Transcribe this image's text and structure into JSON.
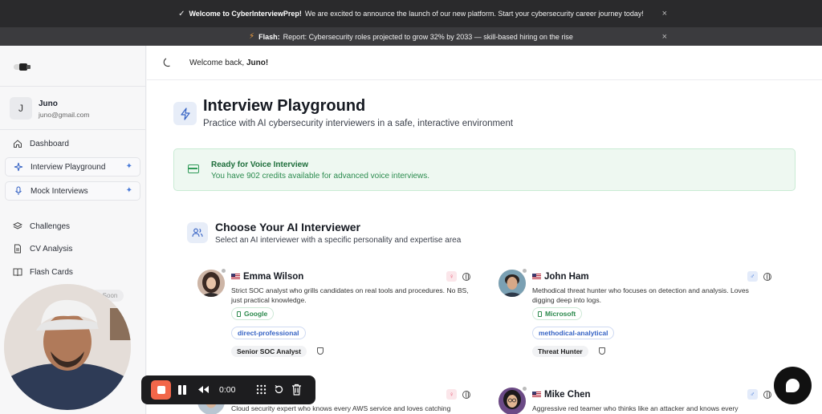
{
  "banners": {
    "welcome": {
      "bold": "Welcome to CyberInterviewPrep!",
      "text": "We are excited to announce the launch of our new platform. Start your cybersecurity career journey today!",
      "close": "×"
    },
    "flash": {
      "bold": "Flash:",
      "text": "Report: Cybersecurity roles projected to grow 32% by 2033 — skill-based hiring on the rise",
      "close": "×"
    }
  },
  "user": {
    "initial": "J",
    "name": "Juno",
    "email": "juno@gmail.com"
  },
  "sidebar": {
    "items": [
      {
        "label": "Dashboard",
        "icon": "home-icon"
      },
      {
        "label": "Interview Playground",
        "icon": "sparkles-icon",
        "badge": "✦"
      },
      {
        "label": "Mock Interviews",
        "icon": "mic-icon",
        "badge": "✦"
      },
      {
        "label": "Challenges",
        "icon": "layers-icon"
      },
      {
        "label": "CV Analysis",
        "icon": "file-icon"
      },
      {
        "label": "Flash Cards",
        "icon": "book-icon"
      }
    ],
    "soon_pill": "g Soon"
  },
  "topbar": {
    "welcome_prefix": "Welcome back,",
    "welcome_name": "Juno!"
  },
  "page": {
    "title": "Interview Playground",
    "subtitle": "Practice with AI cybersecurity interviewers in a safe, interactive environment"
  },
  "credits": {
    "title": "Ready for Voice Interview",
    "text": "You have 902 credits available for advanced voice interviews."
  },
  "choose": {
    "title": "Choose Your AI Interviewer",
    "subtitle": "Select an AI interviewer with a specific personality and expertise area"
  },
  "interviewers": [
    {
      "name": "Emma Wilson",
      "gender_color": "#e8506d",
      "description": "Strict SOC analyst who grills candidates on real tools and procedures. No BS, just practical knowledge.",
      "company": "Google",
      "style": "direct-professional",
      "role": "Senior SOC Analyst"
    },
    {
      "name": "John Ham",
      "gender_color": "#3a72d6",
      "description": "Methodical threat hunter who focuses on detection and analysis. Loves digging deep into logs.",
      "company": "Microsoft",
      "style": "methodical-analytical",
      "role": "Threat Hunter"
    },
    {
      "name": "",
      "gender_color": "#e8506d",
      "description": "Cloud security expert who knows every AWS service and loves catching"
    },
    {
      "name": "Mike Chen",
      "gender_color": "#3a72d6",
      "description": "Aggressive red teamer who thinks like an attacker and knows every"
    }
  ],
  "recorder": {
    "time": "0:00"
  },
  "colors": {
    "accent": "#4b7bd8",
    "success": "#2f9a58",
    "record": "#f2674a"
  }
}
